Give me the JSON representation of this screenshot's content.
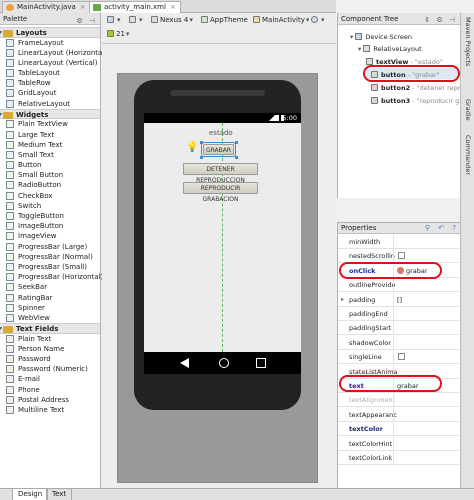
{
  "tabs": [
    {
      "label": "MainActivity.java"
    },
    {
      "label": "activity_main.xml"
    }
  ],
  "toolbar": {
    "api_level": "21",
    "device": "Nexus 4",
    "theme": "AppTheme",
    "activity": "MainActivity"
  },
  "palette": {
    "title": "Palette",
    "groups": [
      {
        "label": "Layouts",
        "items": [
          "FrameLayout",
          "LinearLayout (Horizontal)",
          "LinearLayout (Vertical)",
          "TableLayout",
          "TableRow",
          "GridLayout",
          "RelativeLayout"
        ]
      },
      {
        "label": "Widgets",
        "items": [
          "Plain TextView",
          "Large Text",
          "Medium Text",
          "Small Text",
          "Button",
          "Small Button",
          "RadioButton",
          "CheckBox",
          "Switch",
          "ToggleButton",
          "ImageButton",
          "ImageView",
          "ProgressBar (Large)",
          "ProgressBar (Normal)",
          "ProgressBar (Small)",
          "ProgressBar (Horizontal)",
          "SeekBar",
          "RatingBar",
          "Spinner",
          "WebView"
        ]
      },
      {
        "label": "Text Fields",
        "items": [
          "Plain Text",
          "Person Name",
          "Password",
          "Password (Numeric)",
          "E-mail",
          "Phone",
          "Postal Address",
          "Multiline Text"
        ]
      }
    ]
  },
  "device_screen": {
    "clock": "5:00",
    "textview_text": "estado",
    "button_grabar": "GRABAR",
    "button_detener": "DETENER REPRODUCCION",
    "button_reproducir": "REPRODUCIR GRABACION"
  },
  "component_tree": {
    "title": "Component Tree",
    "nodes": [
      {
        "label": "Device Screen",
        "sub": ""
      },
      {
        "label": "RelativeLayout",
        "sub": ""
      },
      {
        "label": "textView",
        "sub": "- \"estado\""
      },
      {
        "label": "button",
        "sub": "- \"grabar\""
      },
      {
        "label": "button2",
        "sub": "- \"detener repr"
      },
      {
        "label": "button3",
        "sub": "- \"reproducir g"
      }
    ]
  },
  "properties": {
    "title": "Properties",
    "rows": [
      {
        "name": "minWidth",
        "value": ""
      },
      {
        "name": "nestedScrollin",
        "value": ""
      },
      {
        "name": "onClick",
        "value": "grabar"
      },
      {
        "name": "outlineProvide",
        "value": ""
      },
      {
        "name": "padding",
        "value": "[]"
      },
      {
        "name": "paddingEnd",
        "value": ""
      },
      {
        "name": "paddingStart",
        "value": ""
      },
      {
        "name": "shadowColor",
        "value": ""
      },
      {
        "name": "singleLine",
        "value": ""
      },
      {
        "name": "stateListAnima",
        "value": ""
      },
      {
        "name": "text",
        "value": "grabar"
      },
      {
        "name": "textAlignment",
        "value": ""
      },
      {
        "name": "textAppearanc",
        "value": ""
      },
      {
        "name": "textColor",
        "value": ""
      },
      {
        "name": "textColorHint",
        "value": ""
      },
      {
        "name": "textColorLink",
        "value": ""
      }
    ]
  },
  "side_tabs": [
    "Maven Projects",
    "Gradle",
    "Commander"
  ],
  "bottom_tabs": [
    "Design",
    "Text"
  ]
}
